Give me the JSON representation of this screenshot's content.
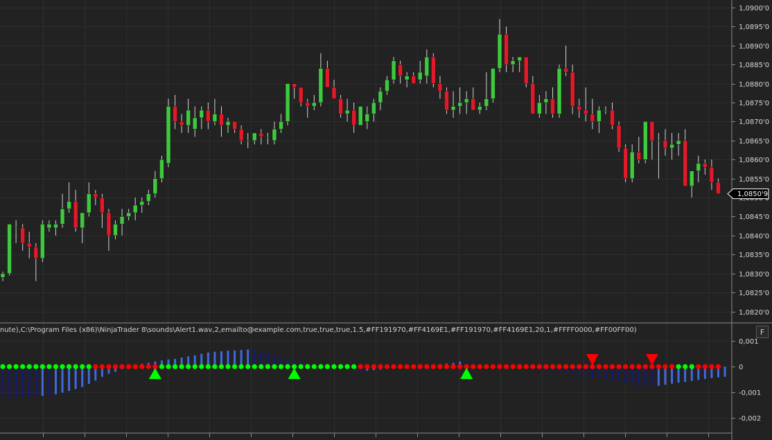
{
  "colors": {
    "background": "#222222",
    "grid": "#2e2e2e",
    "axis_line": "#8c8c8c",
    "up_candle": "#3ec93e",
    "down_candle": "#e11a2a",
    "wick": "#d4d4d4",
    "hist_positive": "#4169E1",
    "hist_negative": "#191970",
    "dot_green": "#00ff00",
    "dot_red": "#ff0000",
    "arrow_up": "#00ff00",
    "arrow_down": "#ff0000"
  },
  "price_axis": {
    "ticks": [
      "1,0820'0",
      "1,0825'0",
      "1,0830'0",
      "1,0835'0",
      "1,0840'0",
      "1,0845'0",
      "1,0850'0",
      "1,0855'0",
      "1,0860'0",
      "1,0865'0",
      "1,0870'0",
      "1,0875'0",
      "1,0880'0",
      "1,0885'0",
      "1,0890'0",
      "1,0895'0",
      "1,0900'0"
    ],
    "last_price": "1,0850'9"
  },
  "indicator_axis": {
    "ticks": [
      "0,001",
      "0",
      "-0,001",
      "-0,002"
    ]
  },
  "indicator_label": "nute),C:\\Program Files (x86)\\NinjaTrader 8\\sounds\\Alert1.wav,2,emailto@example.com,true,true,true,1.5,#FF191970,#FF4169E1,#FF191970,#FF4169E1,20,1,#FFFF0000,#FF00FF00)",
  "f_button": "F",
  "chart_data": [
    {
      "type": "candlestick",
      "ylim": [
        1.0817,
        1.0902
      ],
      "grid": true,
      "candles": [
        [
          1.0829,
          1.08305,
          1.0828,
          1.083
        ],
        [
          1.083,
          1.0843,
          1.08295,
          1.0843
        ],
        [
          1.0842,
          1.0844,
          1.0838,
          1.0842
        ],
        [
          1.0842,
          1.0843,
          1.0836,
          1.0838
        ],
        [
          1.0838,
          1.0841,
          1.0834,
          1.0837
        ],
        [
          1.0837,
          1.0838,
          1.0828,
          1.0834
        ],
        [
          1.0834,
          1.0844,
          1.0833,
          1.0843
        ],
        [
          1.0842,
          1.0844,
          1.0841,
          1.0843
        ],
        [
          1.0842,
          1.0844,
          1.084,
          1.0843
        ],
        [
          1.0843,
          1.0851,
          1.0842,
          1.0847
        ],
        [
          1.0847,
          1.0854,
          1.0846,
          1.0849
        ],
        [
          1.0849,
          1.0852,
          1.0841,
          1.0842
        ],
        [
          1.0842,
          1.0846,
          1.0838,
          1.0846
        ],
        [
          1.0846,
          1.0854,
          1.0845,
          1.0851
        ],
        [
          1.0851,
          1.0852,
          1.0848,
          1.085
        ],
        [
          1.085,
          1.0851,
          1.0842,
          1.0846
        ],
        [
          1.0846,
          1.0847,
          1.0836,
          1.084
        ],
        [
          1.084,
          1.0844,
          1.0839,
          1.0843
        ],
        [
          1.0843,
          1.0847,
          1.084,
          1.0845
        ],
        [
          1.0845,
          1.0847,
          1.0844,
          1.0846
        ],
        [
          1.0846,
          1.085,
          1.0844,
          1.0848
        ],
        [
          1.0848,
          1.085,
          1.0846,
          1.0849
        ],
        [
          1.0849,
          1.0852,
          1.0848,
          1.0851
        ],
        [
          1.0851,
          1.0857,
          1.085,
          1.0855
        ],
        [
          1.0855,
          1.0861,
          1.0854,
          1.086
        ],
        [
          1.0859,
          1.0876,
          1.0858,
          1.0874
        ],
        [
          1.0874,
          1.0877,
          1.0868,
          1.087
        ],
        [
          1.087,
          1.0872,
          1.0867,
          1.0869
        ],
        [
          1.0869,
          1.0876,
          1.0867,
          1.0873
        ],
        [
          1.0868,
          1.0874,
          1.0866,
          1.0871
        ],
        [
          1.0871,
          1.0874,
          1.0868,
          1.0873
        ],
        [
          1.0873,
          1.0875,
          1.0868,
          1.087
        ],
        [
          1.087,
          1.0876,
          1.0869,
          1.0872
        ],
        [
          1.0872,
          1.0874,
          1.0866,
          1.0869
        ],
        [
          1.0869,
          1.0871,
          1.0867,
          1.087
        ],
        [
          1.087,
          1.087,
          1.0867,
          1.0868
        ],
        [
          1.0868,
          1.0869,
          1.0864,
          1.0865
        ],
        [
          1.0865,
          1.0867,
          1.0863,
          1.0865
        ],
        [
          1.0865,
          1.0867,
          1.0864,
          1.0867
        ],
        [
          1.0867,
          1.0868,
          1.0864,
          1.0866
        ],
        [
          1.0866,
          1.0867,
          1.0864,
          1.0866
        ],
        [
          1.0865,
          1.087,
          1.0864,
          1.0868
        ],
        [
          1.0868,
          1.0872,
          1.0867,
          1.087
        ],
        [
          1.087,
          1.088,
          1.0869,
          1.088
        ],
        [
          1.088,
          1.088,
          1.0876,
          1.0879
        ],
        [
          1.0879,
          1.0879,
          1.0874,
          1.0875
        ],
        [
          1.0875,
          1.0876,
          1.0871,
          1.0874
        ],
        [
          1.0874,
          1.0877,
          1.0873,
          1.0875
        ],
        [
          1.0875,
          1.0888,
          1.0874,
          1.0884
        ],
        [
          1.0884,
          1.0886,
          1.0879,
          1.0879
        ],
        [
          1.0879,
          1.0881,
          1.0876,
          1.0876
        ],
        [
          1.0876,
          1.0877,
          1.0871,
          1.0872
        ],
        [
          1.0872,
          1.0876,
          1.087,
          1.0873
        ],
        [
          1.0873,
          1.0875,
          1.0867,
          1.0869
        ],
        [
          1.0869,
          1.0874,
          1.0869,
          1.0874
        ],
        [
          1.087,
          1.0874,
          1.0868,
          1.0872
        ],
        [
          1.0872,
          1.0876,
          1.087,
          1.0875
        ],
        [
          1.0875,
          1.0879,
          1.0873,
          1.0878
        ],
        [
          1.0878,
          1.0882,
          1.0877,
          1.0881
        ],
        [
          1.0881,
          1.0887,
          1.088,
          1.0886
        ],
        [
          1.0885,
          1.0886,
          1.088,
          1.0882
        ],
        [
          1.0881,
          1.0883,
          1.0879,
          1.0882
        ],
        [
          1.0882,
          1.0883,
          1.088,
          1.088
        ],
        [
          1.0881,
          1.0886,
          1.088,
          1.0883
        ],
        [
          1.0882,
          1.0889,
          1.088,
          1.0887
        ],
        [
          1.0887,
          1.0888,
          1.0879,
          1.088
        ],
        [
          1.088,
          1.0882,
          1.0876,
          1.0878
        ],
        [
          1.0878,
          1.0879,
          1.0872,
          1.0873
        ],
        [
          1.0873,
          1.0878,
          1.0871,
          1.0874
        ],
        [
          1.0874,
          1.0879,
          1.0872,
          1.0875
        ],
        [
          1.0875,
          1.0878,
          1.0872,
          1.0876
        ],
        [
          1.0876,
          1.0879,
          1.0873,
          1.0873
        ],
        [
          1.0873,
          1.0875,
          1.0872,
          1.0874
        ],
        [
          1.0874,
          1.0883,
          1.0873,
          1.0876
        ],
        [
          1.0876,
          1.0883,
          1.0875,
          1.0884
        ],
        [
          1.0884,
          1.0897,
          1.0883,
          1.0893
        ],
        [
          1.0893,
          1.0895,
          1.0883,
          1.0885
        ],
        [
          1.0885,
          1.0887,
          1.0883,
          1.0886
        ],
        [
          1.0886,
          1.0887,
          1.0883,
          1.0887
        ],
        [
          1.0887,
          1.0887,
          1.0879,
          1.088
        ],
        [
          1.088,
          1.0882,
          1.0872,
          1.0872
        ],
        [
          1.0872,
          1.0877,
          1.0871,
          1.0875
        ],
        [
          1.0875,
          1.0878,
          1.0872,
          1.0876
        ],
        [
          1.0876,
          1.0879,
          1.0871,
          1.0872
        ],
        [
          1.0872,
          1.0885,
          1.0871,
          1.0884
        ],
        [
          1.0884,
          1.089,
          1.0882,
          1.0883
        ],
        [
          1.0883,
          1.0885,
          1.0872,
          1.0874
        ],
        [
          1.0874,
          1.0876,
          1.0871,
          1.0873
        ],
        [
          1.0873,
          1.0879,
          1.087,
          1.0872
        ],
        [
          1.0872,
          1.0876,
          1.0868,
          1.087
        ],
        [
          1.087,
          1.0874,
          1.0867,
          1.0873
        ],
        [
          1.0873,
          1.0874,
          1.0872,
          1.0873
        ],
        [
          1.0873,
          1.0875,
          1.0868,
          1.0869
        ],
        [
          1.0869,
          1.087,
          1.0862,
          1.0863
        ],
        [
          1.0863,
          1.0864,
          1.0854,
          1.0855
        ],
        [
          1.0855,
          1.0864,
          1.0854,
          1.0862
        ],
        [
          1.0862,
          1.0866,
          1.0859,
          1.086
        ],
        [
          1.086,
          1.087,
          1.0859,
          1.087
        ],
        [
          1.087,
          1.087,
          1.086,
          1.0865
        ],
        [
          1.0865,
          1.0867,
          1.0855,
          1.0865
        ],
        [
          1.0865,
          1.0868,
          1.0861,
          1.0863
        ],
        [
          1.0863,
          1.0867,
          1.086,
          1.0864
        ],
        [
          1.0864,
          1.0867,
          1.0861,
          1.0865
        ],
        [
          1.0865,
          1.0868,
          1.0854,
          1.0853
        ],
        [
          1.0853,
          1.0857,
          1.085,
          1.0857
        ],
        [
          1.0857,
          1.0861,
          1.0854,
          1.0859
        ],
        [
          1.0859,
          1.086,
          1.0856,
          1.0858
        ],
        [
          1.0858,
          1.086,
          1.0852,
          1.0854
        ],
        [
          1.0854,
          1.0855,
          1.0851,
          1.0851
        ]
      ]
    },
    {
      "type": "bar",
      "ylim": [
        -0.0026,
        0.0016
      ],
      "values": [
        -0.0011,
        -0.0012,
        -0.0012,
        -0.0012,
        -0.0012,
        -0.0012,
        -0.00115,
        -0.0012,
        -0.00108,
        -0.00102,
        -0.00095,
        -0.00088,
        -0.0008,
        -0.00068,
        -0.00055,
        -0.0004,
        -0.00028,
        -0.0002,
        -0.0001,
        -3e-05,
        6e-05,
        0.00011,
        0.00015,
        0.0002,
        0.00024,
        0.00028,
        0.0003,
        0.00035,
        0.0004,
        0.00044,
        0.0005,
        0.00055,
        0.00058,
        0.0006,
        0.00062,
        0.00063,
        0.00065,
        0.00067,
        0.00066,
        0.00062,
        0.00055,
        0.00045,
        0.00035,
        0.00028,
        0.00022,
        0.00015,
        0.0001,
        6e-05,
        3e-05,
        1e-05,
        -3e-05,
        -8e-05,
        -0.00012,
        -0.00015,
        -0.00017,
        -0.00016,
        -0.00014,
        -0.00011,
        -7e-05,
        -5e-05,
        -3e-05,
        -1e-05,
        1e-05,
        3e-05,
        5e-05,
        8e-05,
        0.0001,
        0.00012,
        0.00015,
        0.0002,
        0.00018,
        0.00014,
        0.0001,
        6e-05,
        3e-05,
        1e-05,
        -1e-05,
        -3e-05,
        -5e-05,
        -7e-05,
        -0.0001,
        -0.00012,
        -0.00015,
        -0.00018,
        -0.0002,
        -0.00024,
        -0.00026,
        -0.0003,
        -0.00035,
        -0.0004,
        -0.00045,
        -0.0005,
        -0.00055,
        -0.0006,
        -0.00065,
        -0.00068,
        -0.00072,
        -0.00075,
        -0.00077,
        -0.00075,
        -0.00071,
        -0.00067,
        -0.00063,
        -0.0006,
        -0.00056,
        -0.00052,
        -0.00048,
        -0.00045,
        -0.00042,
        -0.0004
      ],
      "dots": "ggggggggggggggrrrrrrrrrrggggggggggggggggggggggggggggggrrrrrrrrrrrrrrrrrrrrrrrrrrrrrrrrrrrrrrrrrrrrrrrrgggrrrrrrrrrrrrrrrr",
      "markers": [
        {
          "direction": "up",
          "index": 23
        },
        {
          "direction": "up",
          "index": 44
        },
        {
          "direction": "up",
          "index": 70
        },
        {
          "direction": "down",
          "index": 89
        },
        {
          "direction": "down",
          "index": 98
        }
      ]
    }
  ]
}
